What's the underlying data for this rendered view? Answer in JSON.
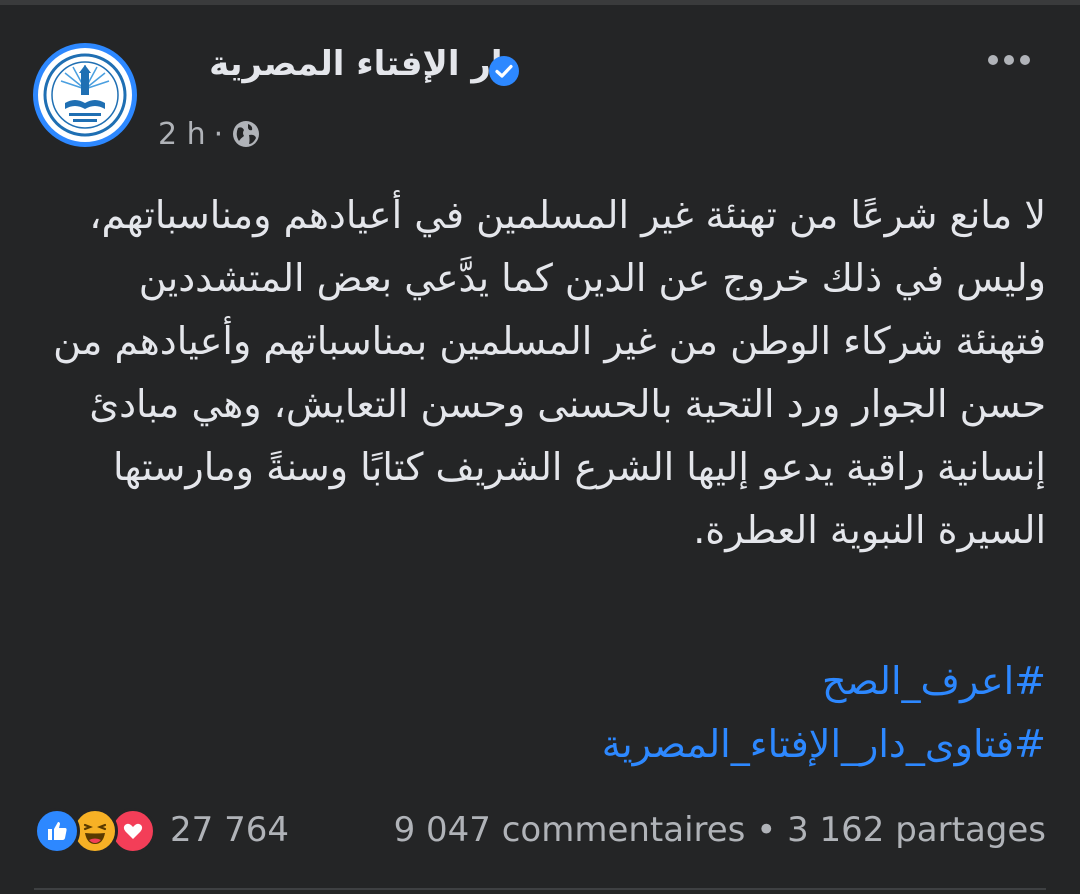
{
  "post": {
    "page_name": "دار الإفتاء المصرية",
    "time": "2 h",
    "separator": "·",
    "lines": [
      "لا مانع شرعًا من تهنئة غير المسلمين في أعيادهم ومناسباتهم،",
      "وليس في ذلك خروج عن الدين كما يدَّعي بعض المتشددين",
      "فتهنئة شركاء الوطن من غير المسلمين بمناسباتهم وأعيادهم من",
      "حسن الجوار ورد التحية بالحسنى وحسن التعايش، وهي مبادئ",
      "إنسانية راقية يدعو إليها الشرع الشريف كتابًا وسنةً ومارستها",
      "السيرة النبوية العطرة."
    ],
    "hashtags": [
      "#اعرف_الصح",
      "#فتاوى_دار_الإفتاء_المصرية"
    ],
    "reaction_count": "27 764",
    "reactions": [
      "like-icon",
      "haha-icon",
      "love-icon"
    ],
    "comments": "9 047 commentaires",
    "stats_separator": "•",
    "shares": "3 162 partages"
  },
  "colors": {
    "background": "#242526",
    "text": "#e4e6eb",
    "secondary_text": "#b0b3b8",
    "link": "#2d88ff",
    "like": "#2d88ff",
    "haha": "#f7b125",
    "love": "#f33e58"
  }
}
